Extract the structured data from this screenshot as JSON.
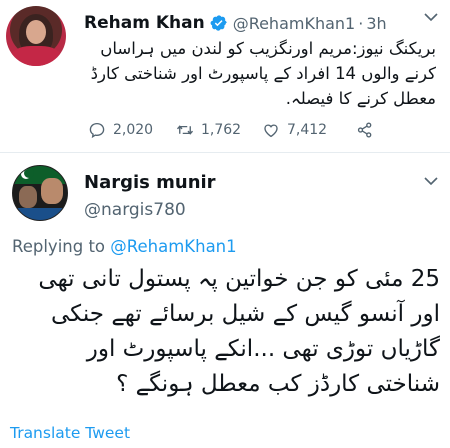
{
  "tweet1": {
    "author_name": "Reham Khan",
    "handle": "@RehamKhan1",
    "separator": "·",
    "time": "3h",
    "text": "بریکنگ نیوز:مریم اورنگزیب کو لندن میں ہراساں کرنے والوں 14 افراد کے پاسپورٹ اور شناختی کارڈ معطل کرنے کا فیصلہ.",
    "counts": {
      "replies": "2,020",
      "retweets": "1,762",
      "likes": "7,412"
    }
  },
  "tweet2": {
    "author_name": "Nargis munir",
    "handle": "@nargis780",
    "replying_prefix": "Replying to",
    "replying_to": "@RehamKhan1",
    "text": "25 مئی کو جن خواتین پہ پستول تانی تھی اور آنسو گیس کے شیل برسائے تھے جنکی گاڑیاں توڑی تھی ...انکے پاسپورٹ اور شناختی کارڈز کب معطل ہونگے ؟",
    "translate_label": "Translate Tweet"
  },
  "colors": {
    "link_blue": "#1d9bf0",
    "secondary_text": "#536471",
    "primary_text": "#0f1419",
    "verified_badge": "#1d9bf0"
  },
  "icons": {
    "reply": "speech-bubble",
    "retweet": "retweet-arrows",
    "like": "heart",
    "share": "share-nodes",
    "more": "chevron-down",
    "verified": "verified-badge"
  }
}
